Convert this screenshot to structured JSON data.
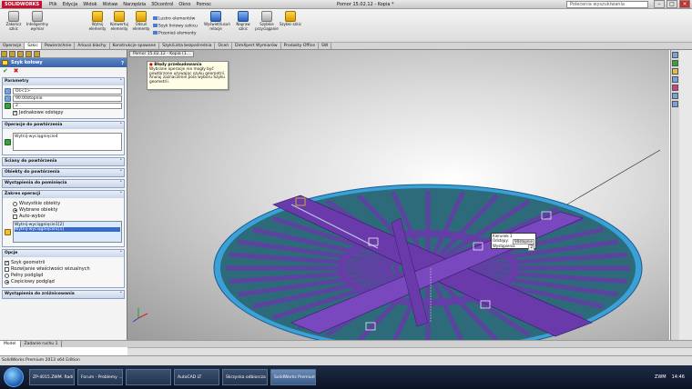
{
  "app": {
    "logo": "SOLIDWORKS",
    "title": "Pomor 15.02.12 - Kopia *",
    "search_placeholder": "Polecenia wyszukiwania"
  },
  "menu": [
    "Plik",
    "Edycja",
    "Widok",
    "Wstaw",
    "Narzędzia",
    "3Dcontrol",
    "Okno",
    "Pomoc"
  ],
  "ribbon": {
    "buttons": [
      "Zakończ szkic",
      "Inteligentny wymiar",
      "Wytnij elementy",
      "Konwertuj elementy",
      "Odsuń elementy",
      "Wyświetl/usuń relacje",
      "Napraw szkic",
      "Szybkie przyciąganie",
      "Szybki szkic"
    ],
    "small": [
      "Lustro elementów",
      "Szyk liniowy szkicu",
      "Przenieś elementy"
    ]
  },
  "command_tabs": [
    "Operacje",
    "Szkic",
    "Powierzchnie",
    "Arkusz blachy",
    "Konstrukcje spawane",
    "Szyk/Lista bezpośrednia",
    "Oceń",
    "DimXpert Wymiarów",
    "Produkty Office",
    "SW"
  ],
  "panel": {
    "title": "Szyk kołowy",
    "sections": {
      "params": "Parametry",
      "ops": "Operacje do powtórzenia",
      "faces": "Ściany do powtórzenia",
      "bodies": "Obiekty do powtórzenia",
      "skip": "Wystąpienia do pominięcia",
      "range": "Zakres operacji",
      "options": "Opcje",
      "vary": "Wystąpienia do zróżnicowania"
    },
    "axis_value": "Oś<1>",
    "angle_value": "90.00stopnie",
    "count_value": "2",
    "equal_spacing": "Jednakowe odstępy",
    "op_list": [
      "Wytnij-wyciągnięcie4"
    ],
    "range_options": [
      "Wszystkie obiekty",
      "Wybrane obiekty",
      "Auto-wybór"
    ],
    "range_list": [
      "Wytnij-wyciągnięcie1[2]",
      "Wytnij-wyciągnięcie1[1]"
    ],
    "options_list": [
      "Szyk geometrii",
      "Rozwijanie właściwości wizualnych",
      "Pełny podgląd",
      "Częściowy podgląd"
    ]
  },
  "viewport": {
    "doc_tab": "Pomor 15.02.12 - Kopia (1...",
    "tooltip_title": "Błędy przebudowania",
    "tooltip_text": "Wybrane operacje nie mogły być powtórzone używając szyku geometrii. Anuluj zaznaczenie pola wyboru Szyku geometrii.",
    "callout": {
      "rows": [
        [
          "Kierunek 1",
          ""
        ],
        [
          "Odstępy:",
          "90stopnie"
        ],
        [
          "Wystąpienia",
          "2"
        ]
      ]
    }
  },
  "bottom_tabs": [
    "Model",
    "Zadanie ruchu 1"
  ],
  "status": "SolidWorks Premium 2013 x64 Edition",
  "taskbar": {
    "items": [
      "ZP-4015.ZWM. Radi...",
      "Forum - Problemy ...",
      "",
      "AutoCAD LT",
      "Skrzynka odbiorcza -",
      "SolidWorks Premium..."
    ],
    "tray": [
      "ZWM",
      "14:46"
    ]
  },
  "colors": {
    "part": "#2d6a7a",
    "rim": "#3aa0d8",
    "member": "#6a3aaa",
    "accent": "#3a62a8"
  }
}
